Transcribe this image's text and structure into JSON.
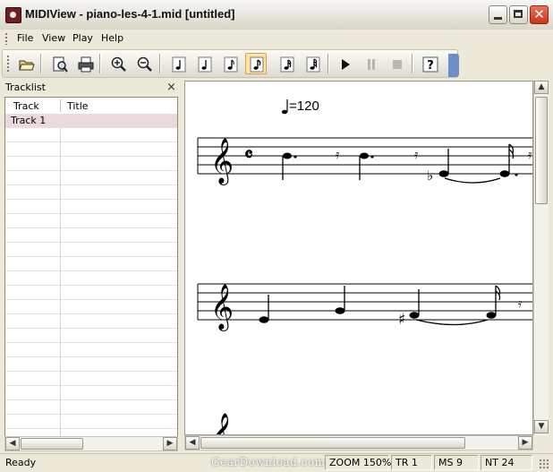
{
  "window": {
    "title": "MIDIView - piano-les-4-1.mid [untitled]"
  },
  "menu": [
    "File",
    "View",
    "Play",
    "Help"
  ],
  "toolbar": {
    "buttons": [
      "open",
      "print-preview",
      "print",
      "zoom-in",
      "zoom-out",
      "whole-note",
      "half-note",
      "quarter-note",
      "eighth-note",
      "sixteenth-note",
      "thirty-second-note",
      "play",
      "pause",
      "stop",
      "help"
    ],
    "active": "eighth-note"
  },
  "tracklist": {
    "title": "Tracklist",
    "close_glyph": "×",
    "columns": [
      "Track",
      "Title"
    ],
    "rows": [
      {
        "track": "Track 1",
        "title": ""
      }
    ]
  },
  "score": {
    "tempo": "=120"
  },
  "status": {
    "text": "Ready",
    "zoom": "ZOOM 150%",
    "track": "TR 1",
    "ms": "MS 9",
    "nt": "NT 24"
  },
  "watermark": "GearDownload.com",
  "colors": {
    "titlebar_close": "#c8341a",
    "active_button": "#fde3a8",
    "selected_row": "#ecd9dc"
  }
}
